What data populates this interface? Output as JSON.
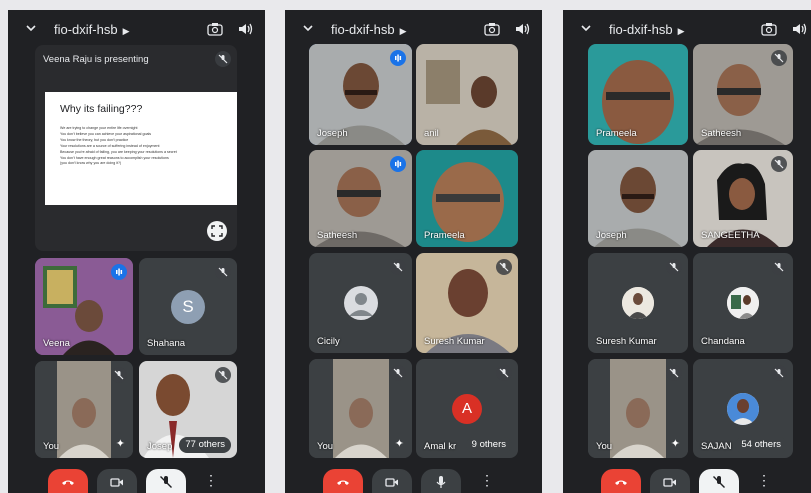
{
  "meeting_code": "fio-dxif-hsb",
  "presentation": {
    "header": "Veena Raju is presenting",
    "slide_title": "Why its failing???",
    "bullets": [
      "We are trying to change your entire life overnight",
      "You don't believe you can achieve your aspirational goals",
      "You know the theory, but you don't practice",
      "Your resolutions are a source of suffering instead of enjoyment",
      "Because you're afraid of failing, you are keeping your resolutions a secret",
      "You don't have enough great reasons to accomplish your resolutions",
      "(you don't know why you are doing it?)"
    ]
  },
  "screen1": {
    "tiles": [
      "Veena",
      "Shahana",
      "You",
      "Josep"
    ],
    "shahana_initial": "S",
    "others": "77 others"
  },
  "screen2": {
    "tiles": [
      "Joseph",
      "anil",
      "Satheesh",
      "Prameela",
      "Cicily",
      "Suresh Kumar",
      "You",
      "Amal kr"
    ],
    "amal_initial": "A",
    "others": "9 others"
  },
  "screen3": {
    "tiles": [
      "Prameela",
      "Satheesh",
      "Joseph",
      "SANGEETHA",
      "Suresh Kumar",
      "Chandana",
      "You",
      "SAJAN"
    ],
    "others": "54 others"
  },
  "colors": {
    "background": "#202124",
    "tile": "#3c4043",
    "accent": "#8ab4f8",
    "end_call": "#ea4335",
    "speaking": "#1a73e8"
  },
  "icons": [
    "chevron-down-icon",
    "camera-switch-icon",
    "speaker-icon",
    "mic-off-icon",
    "speaking-icon",
    "fullscreen-icon",
    "end-call-icon",
    "video-icon",
    "mic-icon",
    "more-options-icon",
    "sparkle-icon"
  ]
}
